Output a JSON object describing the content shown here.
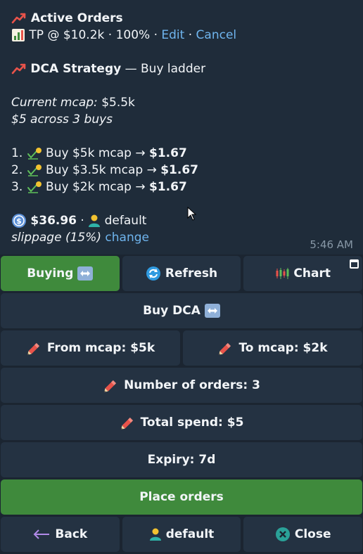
{
  "message": {
    "active_orders_title": "Active Orders",
    "tp_text": "TP @ $10.2k · 100% ·",
    "edit_link": "Edit",
    "separator": "·",
    "cancel_link": "Cancel",
    "dca_title": "DCA Strategy",
    "dca_subtitle": " — Buy ladder",
    "current_mcap_label": "Current mcap:",
    "current_mcap_value": "$5.5k",
    "summary": "$5 across 3 buys",
    "orders": [
      {
        "num": "1.",
        "text": "Buy $5k mcap →",
        "amount": "$1.67"
      },
      {
        "num": "2.",
        "text": "Buy $3.5k mcap →",
        "amount": "$1.67"
      },
      {
        "num": "3.",
        "text": "Buy $2k mcap →",
        "amount": "$1.67"
      }
    ],
    "balance": "$36.96",
    "balance_sep": " ·",
    "wallet": "default",
    "slippage": "slippage (15%)",
    "change_link": "change",
    "time": "5:46 AM"
  },
  "keyboard": {
    "buying": "Buying",
    "refresh": "Refresh",
    "chart": "Chart",
    "buy_dca": "Buy DCA",
    "from_mcap": "From mcap: $5k",
    "to_mcap": "To mcap: $2k",
    "num_orders": "Number of orders: 3",
    "total_spend": "Total spend: $5",
    "expiry": "Expiry: 7d",
    "place_orders": "Place orders",
    "back": "Back",
    "wallet": "default",
    "close": "Close"
  },
  "colors": {
    "background": "#1b2531",
    "message_bg": "#1f2c3a",
    "button_bg": "#243242",
    "green": "#3f8a3c",
    "link": "#6fb5ee"
  }
}
